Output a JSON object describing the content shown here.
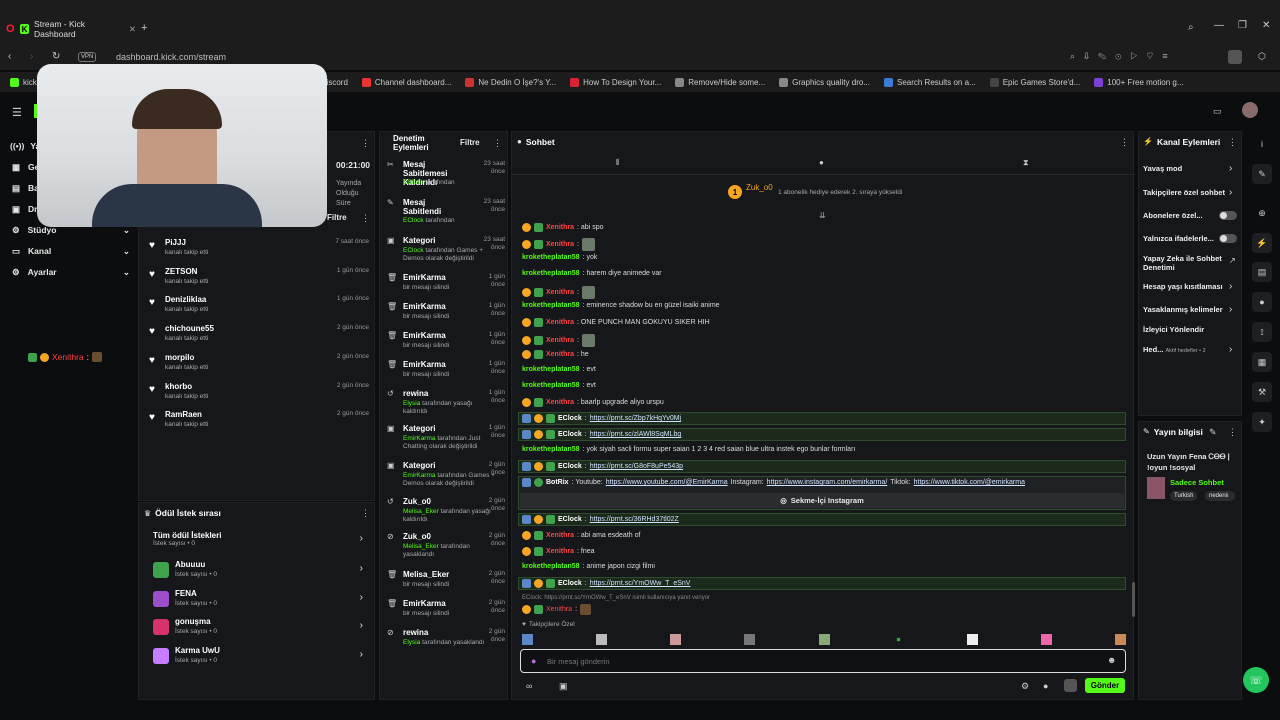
{
  "browser": {
    "tab_title": "Stream - Kick Dashboard",
    "url": "dashboard.kick.com/stream",
    "vpn": "VPN",
    "bookmarks": [
      "kick",
      "Discord",
      "Channel dashboard...",
      "Ne Dedin O İşe?'s Y...",
      "How To Design Your...",
      "Remove/Hide some...",
      "Graphics quality dro...",
      "Search Results on a...",
      "Epic Games Store'd...",
      "100+ Free motion g..."
    ]
  },
  "colors": {
    "accent": "#53fc18",
    "username_red": "#ff4444",
    "panel": "#15171a"
  },
  "left_nav": {
    "items": [
      {
        "label": "Ya...",
        "icon": "broadcast-icon"
      },
      {
        "label": "Ge...",
        "icon": "grid-icon"
      },
      {
        "label": "Ba...",
        "icon": "bar-icon"
      },
      {
        "label": "Dr...",
        "icon": "drops-icon"
      },
      {
        "label": "Stüdyo",
        "icon": "studio-icon"
      },
      {
        "label": "Kanal",
        "icon": "channel-icon"
      },
      {
        "label": "Ayarlar",
        "icon": "gear-icon"
      }
    ],
    "stream_time": "00:21:00",
    "stream_time_label": "Yayında Olduğu Süre",
    "preview_user": "Xenithra",
    "preview_sep": ":"
  },
  "activity": {
    "filter": "Filtre",
    "items": [
      {
        "name": "PiJJJ",
        "sub": "kanalı takip etti",
        "time": "7 saat önce"
      },
      {
        "name": "ZETSON",
        "sub": "kanalı takip etti",
        "time": "1 gün önce"
      },
      {
        "name": "Denizliklaa",
        "sub": "kanalı takip etti",
        "time": "1 gün önce"
      },
      {
        "name": "chichoune55",
        "sub": "kanalı takip etti",
        "time": "2 gün önce"
      },
      {
        "name": "morpilo",
        "sub": "kanalı takip etti",
        "time": "2 gün önce"
      },
      {
        "name": "khorbo",
        "sub": "kanalı takip etti",
        "time": "2 gün önce"
      },
      {
        "name": "RamRaen",
        "sub": "kanalı takip etti",
        "time": "2 gün önce"
      }
    ]
  },
  "rewards": {
    "title": "Ödül İstek sırası",
    "all_label": "Tüm ödül İstekleri",
    "all_count": "İstek sayısı • 0",
    "items": [
      {
        "name": "Abuuuu",
        "count": "İstek sayısı • 0",
        "color": "#3fa34d"
      },
      {
        "name": "FENA",
        "count": "İstek sayısı • 0",
        "color": "#9b4dca"
      },
      {
        "name": "gonuşma",
        "count": "İstek sayısı • 0",
        "color": "#d6336c"
      },
      {
        "name": "Karma UwU",
        "count": "İstek sayısı • 0",
        "color": "#c77dff"
      }
    ]
  },
  "moderation": {
    "title": "Denetim Eylemleri",
    "filter": "Filtre",
    "items": [
      {
        "title": "Mesaj Sabitlemesi Kaldırıldı",
        "actor": "EClock",
        "rest": " tarafından",
        "time": "23 saat önce",
        "icon": "unpin-icon"
      },
      {
        "title": "Mesaj Sabitlendi",
        "actor": "EClock",
        "rest": " tarafından",
        "time": "23 saat önce",
        "icon": "pin-icon"
      },
      {
        "title": "Kategori",
        "actor": "EClock",
        "rest": " tarafından Games + Demos olarak değiştirildi",
        "time": "23 saat önce",
        "icon": "category-icon"
      },
      {
        "title": "EmirKarma",
        "actor": "",
        "rest": "bir mesajı silindi",
        "time": "1 gün önce",
        "icon": "trash-icon"
      },
      {
        "title": "EmirKarma",
        "actor": "",
        "rest": "bir mesajı silindi",
        "time": "1 gün önce",
        "icon": "trash-icon"
      },
      {
        "title": "EmirKarma",
        "actor": "",
        "rest": "bir mesajı silindi",
        "time": "1 gün önce",
        "icon": "trash-icon"
      },
      {
        "title": "EmirKarma",
        "actor": "",
        "rest": "bir mesajı silindi",
        "time": "1 gün önce",
        "icon": "trash-icon"
      },
      {
        "title": "rewina",
        "actor": "Elysia",
        "rest": " tarafından yasağı kaldırıldı",
        "time": "1 gün önce",
        "icon": "undo-icon"
      },
      {
        "title": "Kategori",
        "actor": "EmirKarma",
        "rest": " tarafından Just Chatting olarak değiştirildi",
        "time": "1 gün önce",
        "icon": "category-icon"
      },
      {
        "title": "Kategori",
        "actor": "EmirKarma",
        "rest": " tarafından Games + Demos olarak değiştirildi",
        "time": "2 gün önce",
        "icon": "category-icon"
      },
      {
        "title": "Zuk_o0",
        "actor": "Melisa_Eker",
        "rest": " tarafından yasağı kaldırıldı",
        "time": "2 gün önce",
        "icon": "undo-icon"
      },
      {
        "title": "Zuk_o0",
        "actor": "Melisa_Eker",
        "rest": " tarafından yasaklandı",
        "time": "2 gün önce",
        "icon": "ban-icon"
      },
      {
        "title": "Melisa_Eker",
        "actor": "",
        "rest": "bir mesajı silindi",
        "time": "2 gün önce",
        "icon": "trash-icon"
      },
      {
        "title": "EmirKarma",
        "actor": "",
        "rest": "bir mesajı silindi",
        "time": "2 gün önce",
        "icon": "trash-icon"
      },
      {
        "title": "rewina",
        "actor": "Elysia",
        "rest": " tarafından yasaklandı",
        "time": "2 gün önce",
        "icon": "ban-icon"
      }
    ]
  },
  "chat": {
    "title": "Sohbet",
    "gift_user": "Zuk_o0",
    "gift_count": "1",
    "gift_text": "1 abonelik hediye ederek 2. sıraya yükseldi",
    "messages": [
      {
        "user": "Xenithra",
        "text": ": abi spo",
        "kind": "red"
      },
      {
        "user": "Xenithra",
        "text": ":",
        "kind": "red",
        "emote": true
      },
      {
        "user": "kroketheplatan58",
        "text": ": yok",
        "kind": "green"
      },
      {
        "user": "kroketheplatan58",
        "text": ": harem diye animede var",
        "kind": "green"
      },
      {
        "user": "Xenithra",
        "text": ":",
        "kind": "red",
        "emote": true
      },
      {
        "user": "kroketheplatan58",
        "text": ": eminence shadow bu en güzel isaiki anime",
        "kind": "green"
      },
      {
        "user": "Xenithra",
        "text": ": ONE PUNCH MAN GOKUYU SIKER HIH",
        "kind": "red"
      },
      {
        "user": "Xenithra",
        "text": ":",
        "kind": "red",
        "emote": true
      },
      {
        "user": "Xenithra",
        "text": ": he",
        "kind": "red"
      },
      {
        "user": "kroketheplatan58",
        "text": ": evt",
        "kind": "green"
      },
      {
        "user": "kroketheplatan58",
        "text": ": evt",
        "kind": "green"
      },
      {
        "user": "Xenithra",
        "text": ": baarlp upgrade aliyo urspu",
        "kind": "red"
      },
      {
        "user": "EClock",
        "text": ": ",
        "link": "https://prnt.sc/Zbp7kHqYv0Mj",
        "kind": "mod"
      },
      {
        "user": "EClock",
        "text": ": ",
        "link": "https://prnt.sc/zlAWl8SqMLbg",
        "kind": "mod"
      },
      {
        "user": "kroketheplatan58",
        "text": ": yok siyah sacli formu super saian 1 2 3 4 red saian blue ultra instek ego bunlar formları",
        "kind": "green"
      },
      {
        "user": "EClock",
        "text": ": ",
        "link": "https://prnt.sc/G8oF8uPe543p",
        "kind": "mod"
      }
    ],
    "botrix": {
      "user": "BotRix",
      "prefix": ": Youtube: ",
      "yt": "https://www.youtube.com/@EmirKarma",
      "ig_label": " Instagram: ",
      "ig": "https://www.instagram.com/emirkarma/",
      "tt_label": " Tiktok: ",
      "tt": "https://www.tiktok.com/@emirkarma",
      "button": "Sekme-İçi Instagram"
    },
    "messages2": [
      {
        "user": "EClock",
        "text": ": ",
        "link": "https://prnt.sc/36RHd37tl02Z",
        "kind": "mod"
      },
      {
        "user": "Xenithra",
        "text": ": abi ama esdeath of",
        "kind": "red"
      },
      {
        "user": "Xenithra",
        "text": ": fnea",
        "kind": "red"
      },
      {
        "user": "kroketheplatan58",
        "text": ": anime japon cizgi filmi",
        "kind": "green"
      },
      {
        "user": "EClock",
        "text": ": ",
        "link": "https://prnt.sc/YmOWw_T_eSnV",
        "kind": "mod"
      }
    ],
    "reply_note": "EClock: https://prnt.sc/YmOWw_T_eSnV isimli kullanıcıya yanıt veriyor",
    "last_user": "Xenithra",
    "followers_only": "Takipçilere Özel",
    "input_placeholder": "Bir mesaj gönderin",
    "send": "Gönder"
  },
  "channel_actions": {
    "title": "Kanal Eylemleri",
    "items": [
      {
        "label": "Yavaş mod",
        "control": "chevron"
      },
      {
        "label": "Takipçilere özel sohbet",
        "control": "chevron"
      },
      {
        "label": "Abonelere özel...",
        "control": "toggle"
      },
      {
        "label": "Yalnızca ifadelerle...",
        "control": "toggle"
      },
      {
        "label": "Yapay Zeka ile Sohbet Denetimi",
        "control": "external"
      },
      {
        "label": "Hesap yaşı kısıtlaması",
        "control": "chevron"
      },
      {
        "label": "Yasaklanmış kelimeler",
        "control": "chevron"
      },
      {
        "label": "İzleyici Yönlendir",
        "control": "none"
      },
      {
        "label": "Hed...",
        "control": "chevron",
        "extra": "Aktif hedefler • 2"
      }
    ]
  },
  "stream_info": {
    "title": "Yayın bilgisi",
    "stream_title": "Uzun Yayın Fena ᏟᎾᎾ | !oyun !sosyal",
    "chat_mode": "Sadece Sohbet",
    "tags": [
      "Turkish",
      "nedeniı"
    ]
  }
}
